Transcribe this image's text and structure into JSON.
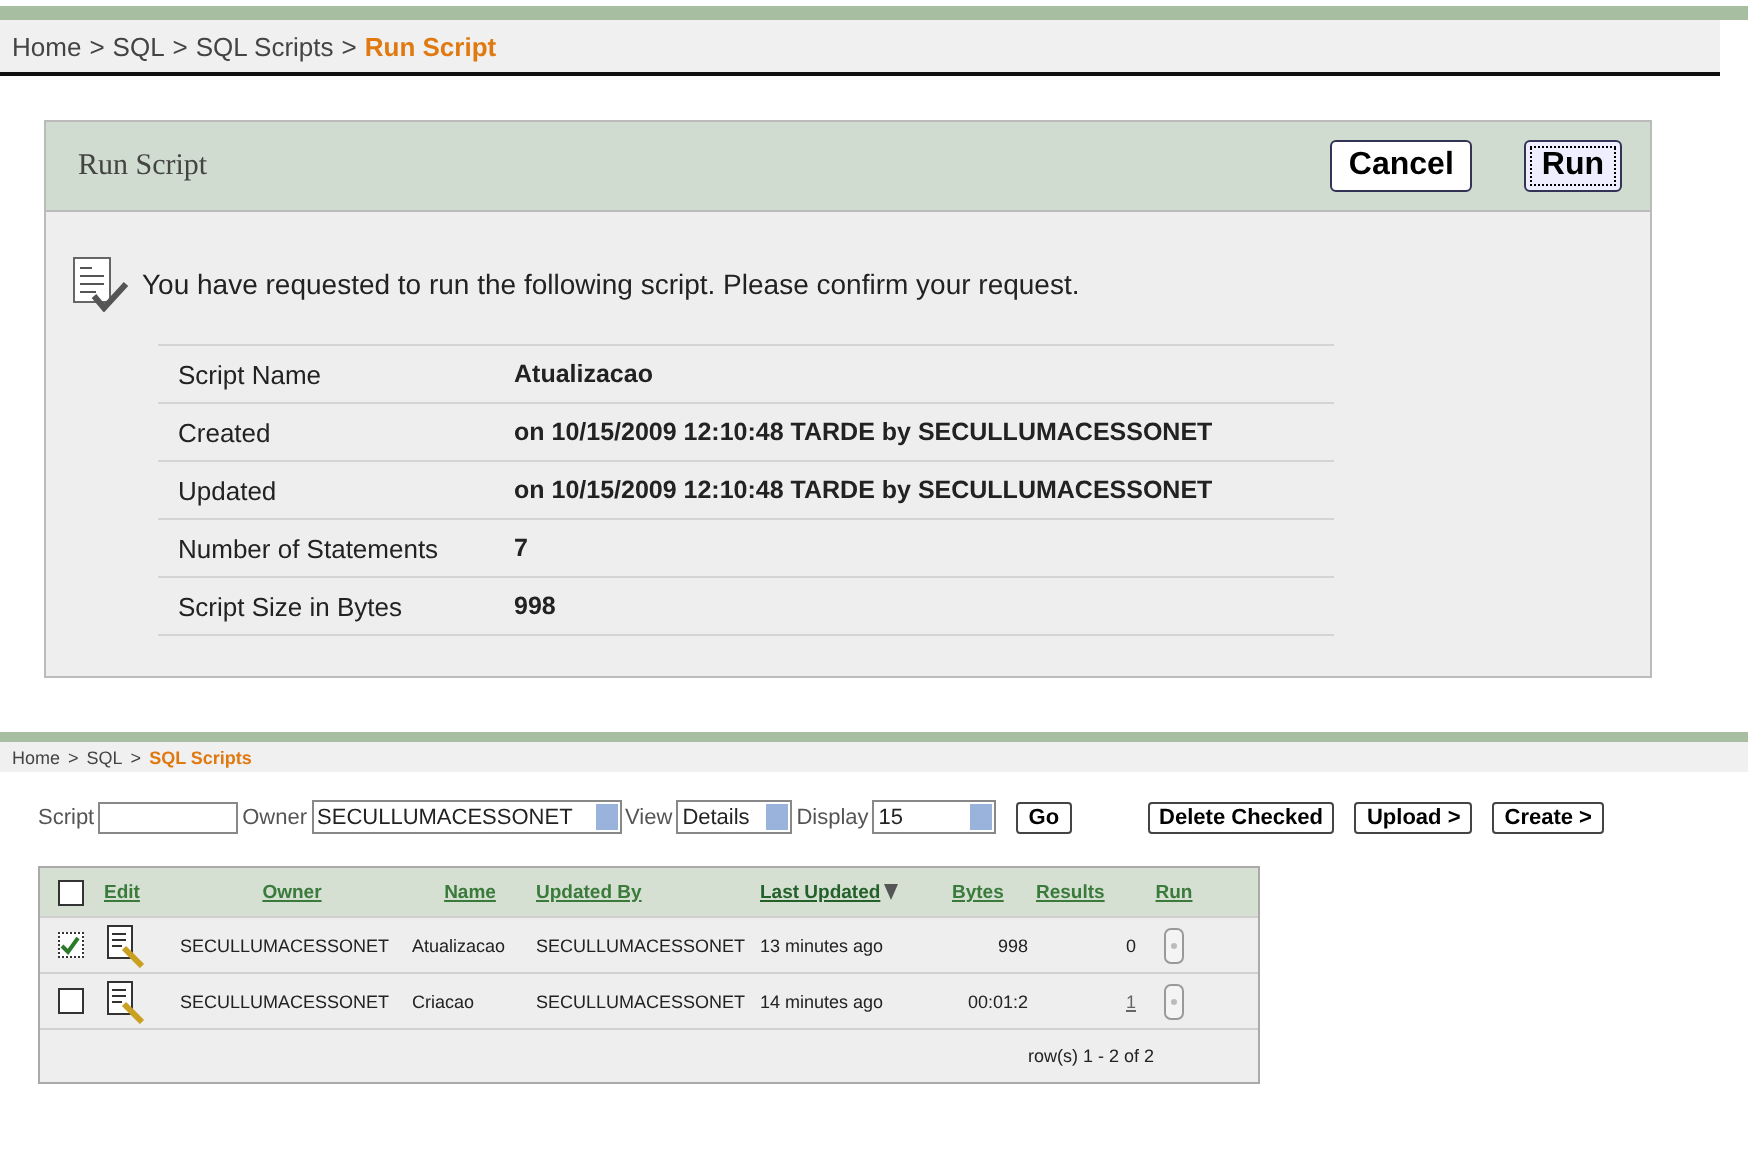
{
  "breadcrumb_separator": ">",
  "breadcrumb": [
    {
      "label": "Home",
      "current": false
    },
    {
      "label": "SQL",
      "current": false
    },
    {
      "label": "SQL Scripts",
      "current": false
    },
    {
      "label": "Run Script",
      "current": true
    }
  ],
  "run_panel": {
    "title": "Run Script",
    "buttons": [
      {
        "label": "Cancel",
        "focused": false
      },
      {
        "label": "Run",
        "focused": true
      }
    ],
    "message": "You have requested to run the following script. Please confirm your request.",
    "details": [
      {
        "label": "Script Name",
        "value": "Atualizacao"
      },
      {
        "label": "Created",
        "value": "on 10/15/2009 12:10:48 TARDE by SECULLUMACESSONET"
      },
      {
        "label": "Updated",
        "value": "on 10/15/2009 12:10:48 TARDE by SECULLUMACESSONET"
      },
      {
        "label": "Number of Statements",
        "value": "7"
      },
      {
        "label": "Script Size in Bytes",
        "value": "998"
      }
    ]
  },
  "scripts_breadcrumb": [
    {
      "label": "Home",
      "current": false
    },
    {
      "label": "SQL",
      "current": false
    },
    {
      "label": "SQL Scripts",
      "current": true
    }
  ],
  "toolbar": {
    "script_label": "Script",
    "owner_label": "Owner",
    "owner_value": "SECULLUMACESSONET",
    "view_label": "View",
    "view_value": "Details",
    "display_label": "Display",
    "display_value": "15",
    "go": "Go",
    "actions": [
      "Delete Checked",
      "Upload >",
      "Create >"
    ]
  },
  "table": {
    "columns": [
      {
        "label": "Edit",
        "sorted": false
      },
      {
        "label": "Owner",
        "sorted": false
      },
      {
        "label": "Name",
        "sorted": false
      },
      {
        "label": "Updated By",
        "sorted": false
      },
      {
        "label": "Last Updated",
        "sorted": true
      },
      {
        "label": "Bytes",
        "sorted": false
      },
      {
        "label": "Results",
        "sorted": false
      },
      {
        "label": "Run",
        "sorted": false
      }
    ],
    "header_checked": false,
    "rows": [
      {
        "checked": true,
        "owner": "SECULLUMACESSONET",
        "name": "Atualizacao",
        "updated_by": "SECULLUMACESSONET",
        "last_updated": "13 minutes ago",
        "bytes": "998",
        "results": "0",
        "results_link": false
      },
      {
        "checked": false,
        "owner": "SECULLUMACESSONET",
        "name": "Criacao",
        "updated_by": "SECULLUMACESSONET",
        "last_updated": "14 minutes ago",
        "bytes": "00:01:2",
        "results": "1",
        "results_link": true
      }
    ],
    "pagination": "row(s) 1 - 2 of 2"
  }
}
